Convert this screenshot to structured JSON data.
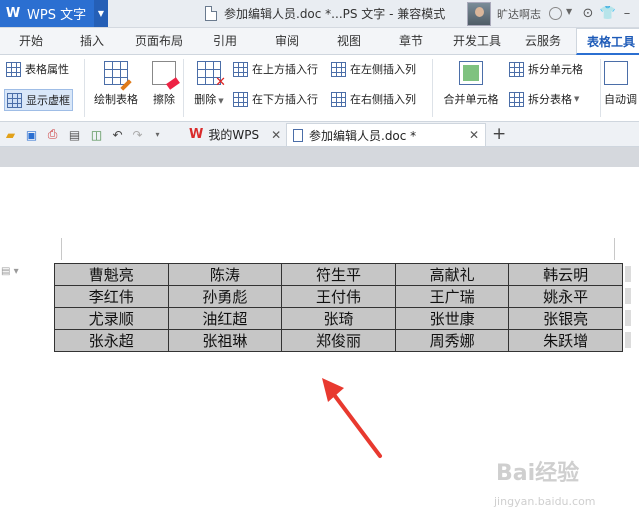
{
  "titlebar": {
    "app_name": "WPS 文字",
    "doc_title": "参加编辑人员.doc *...PS 文字 - 兼容模式",
    "username": "旷达啊志"
  },
  "tabs": [
    "开始",
    "插入",
    "页面布局",
    "引用",
    "审阅",
    "视图",
    "章节",
    "开发工具",
    "云服务",
    "表格工具"
  ],
  "active_tab": "表格工具",
  "ribbon": {
    "table_props": "表格属性",
    "show_gridlines": "显示虚框",
    "draw_table": "绘制表格",
    "erase": "擦除",
    "delete": "删除",
    "insert_above": "在上方插入行",
    "insert_below": "在下方插入行",
    "insert_left": "在左侧插入列",
    "insert_right": "在右侧插入列",
    "merge_cells": "合并单元格",
    "split_cells": "拆分单元格",
    "split_table": "拆分表格",
    "auto_adjust": "自动调"
  },
  "doc_tabs": {
    "my_wps": "我的WPS",
    "current_doc": "参加编辑人员.doc *"
  },
  "table": {
    "rows": [
      [
        "曹魁亮",
        "陈涛",
        "符生平",
        "高献礼",
        "韩云明"
      ],
      [
        "李红伟",
        "孙勇彪",
        "王付伟",
        "王广瑞",
        "姚永平"
      ],
      [
        "尤录顺",
        "油红超",
        "张琦",
        "张世康",
        "张银亮"
      ],
      [
        "张永超",
        "张祖琳",
        "郑俊丽",
        "周秀娜",
        "朱跃增"
      ]
    ]
  },
  "watermark": {
    "brand": "Bai经验",
    "url": "jingyan.baidu.com"
  },
  "colors": {
    "accent": "#2b6fd1",
    "cell_shading": "#c6c6c6",
    "arrow": "#e8392f"
  }
}
